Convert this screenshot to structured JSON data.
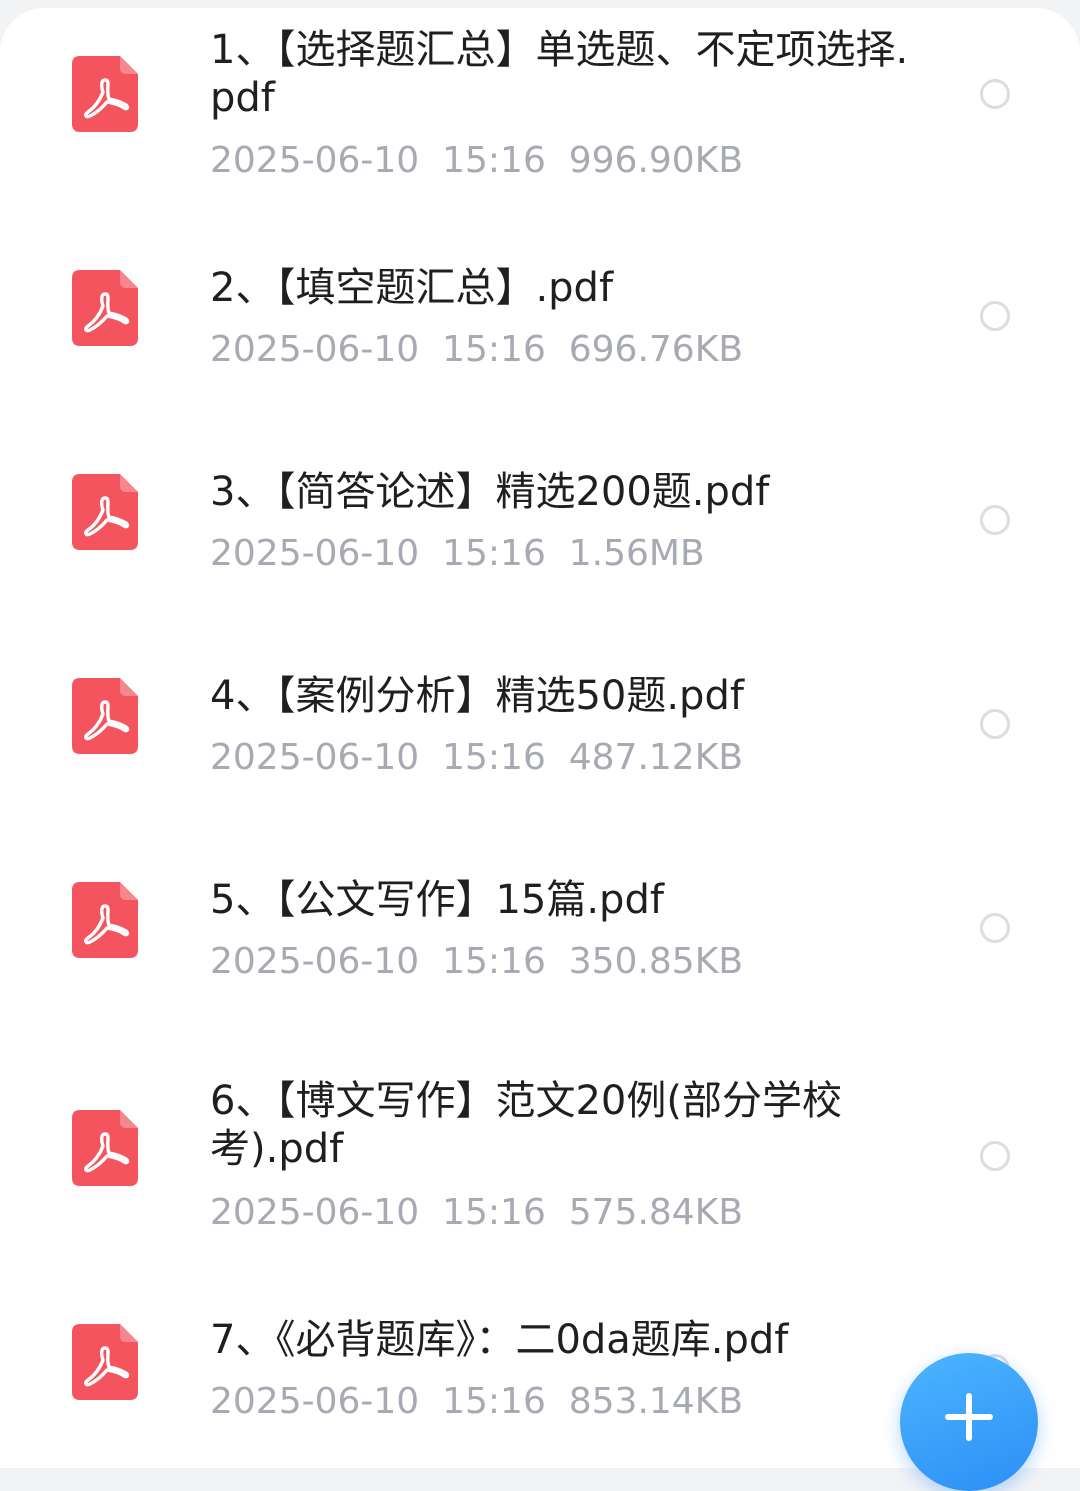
{
  "theme": {
    "accent": "#2b8ff5",
    "pdf_icon_color": "#f4545e",
    "meta_text_color": "#a7a9b3"
  },
  "files": [
    {
      "name": "1、【选择题汇总】单选题、不定项选择.pdf",
      "date": "2025-06-10",
      "time": "15:16",
      "size": "996.90KB",
      "icon": "pdf-icon",
      "selected": false
    },
    {
      "name": "2、【填空题汇总】.pdf",
      "date": "2025-06-10",
      "time": "15:16",
      "size": "696.76KB",
      "icon": "pdf-icon",
      "selected": false
    },
    {
      "name": "3、【简答论述】精选200题.pdf",
      "date": "2025-06-10",
      "time": "15:16",
      "size": "1.56MB",
      "icon": "pdf-icon",
      "selected": false
    },
    {
      "name": "4、【案例分析】精选50题.pdf",
      "date": "2025-06-10",
      "time": "15:16",
      "size": "487.12KB",
      "icon": "pdf-icon",
      "selected": false
    },
    {
      "name": "5、【公文写作】15篇.pdf",
      "date": "2025-06-10",
      "time": "15:16",
      "size": "350.85KB",
      "icon": "pdf-icon",
      "selected": false
    },
    {
      "name": "6、【博文写作】范文20例(部分学校考).pdf",
      "date": "2025-06-10",
      "time": "15:16",
      "size": "575.84KB",
      "icon": "pdf-icon",
      "selected": false
    },
    {
      "name": "7、《必背题库》：二0da题库.pdf",
      "date": "2025-06-10",
      "time": "15:16",
      "size": "853.14KB",
      "icon": "pdf-icon",
      "selected": false
    }
  ],
  "fab": {
    "icon": "plus-icon"
  }
}
